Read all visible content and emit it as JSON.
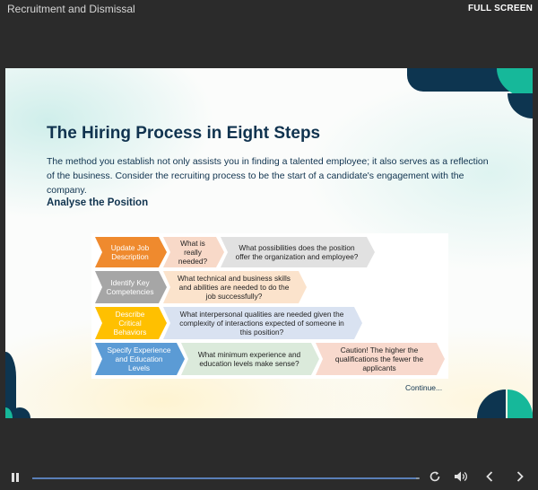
{
  "app": {
    "title": "Recruitment and Dismissal",
    "fullscreen_label": "FULL SCREEN"
  },
  "slide": {
    "title": "The Hiring Process in Eight Steps",
    "intro": "The method you establish not only assists you in finding a talented employee; it also serves as a reflection of the business. Consider the recruiting process to be the start of a candidate's engagement with the company.",
    "section_heading": "Analyse the Position",
    "continue_label": "Continue...",
    "rows": [
      {
        "step": "Update Job Description",
        "color": "#ef8a2e",
        "questions": [
          {
            "text": "What is really needed?",
            "color": "#f8d9c8"
          },
          {
            "text": "What possibilities does the position offer the organization and employee?",
            "color": "#e1e1e1"
          }
        ]
      },
      {
        "step": "Identify Key Competencies",
        "color": "#a6a6a6",
        "questions": [
          {
            "text": "What technical and business skills and abilities are needed to do the job successfully?",
            "color": "#fbe3cc"
          }
        ]
      },
      {
        "step": "Describe Critical Behaviors",
        "color": "#ffc000",
        "questions": [
          {
            "text": "What interpersonal qualities are needed given the complexity of interactions expected of someone in this position?",
            "color": "#d9e2f1"
          }
        ]
      },
      {
        "step": "Specify Experience and Education Levels",
        "color": "#5b9bd5",
        "questions": [
          {
            "text": "What minimum experience and education levels make sense?",
            "color": "#dbeadb"
          },
          {
            "text": "Caution! The higher the qualifications the fewer the applicants",
            "color": "#f8d9cd"
          }
        ]
      }
    ]
  },
  "controls": {
    "progress": 0.99
  },
  "colors": {
    "navy": "#10334f",
    "teal": "#16b89a",
    "darknavy": "#0d3550"
  }
}
